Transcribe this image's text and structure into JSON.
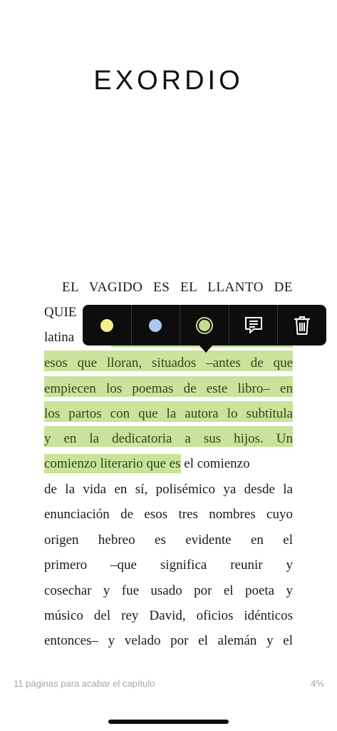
{
  "chapter": {
    "title": "EXORDIO"
  },
  "text": {
    "line1": "EL VAGIDO ES EL LLANTO DE",
    "line2_visible": "QUIE",
    "line3_visible": "latina",
    "line4": "esos que lloran, situados –antes de que",
    "line5": "empiecen los poemas de este libro– en",
    "line6": "los partos con que la autora lo subtitula",
    "line7": "y en la dedicatoria a sus hijos. Un",
    "line8_highlighted": "comienzo literario que es",
    "line8_rest": " el comienzo",
    "line9": "de la vida en sí, polisémico ya desde la",
    "line10": "enunciación de esos tres nombres cuyo",
    "line11": "origen hebreo es evidente en el",
    "line12": "primero –que significa reunir y",
    "line13": "cosechar y fue usado por el poeta y",
    "line14": "músico del rey David, oficios idénticos",
    "line15": "entonces– y velado por el alemán y el"
  },
  "toolbar": {
    "colors": {
      "yellow": "#f7ee8c",
      "blue": "#a9c9ec",
      "green": "#c4dc96"
    },
    "selected_color": "green",
    "icons": [
      "yellow-color-dot",
      "blue-color-dot",
      "green-color-selected",
      "note-icon",
      "trash-icon"
    ]
  },
  "highlight_color": "#c9e39a",
  "footer": {
    "pages_left": "11 páginas para acabar el capítulo",
    "progress": "4%"
  }
}
